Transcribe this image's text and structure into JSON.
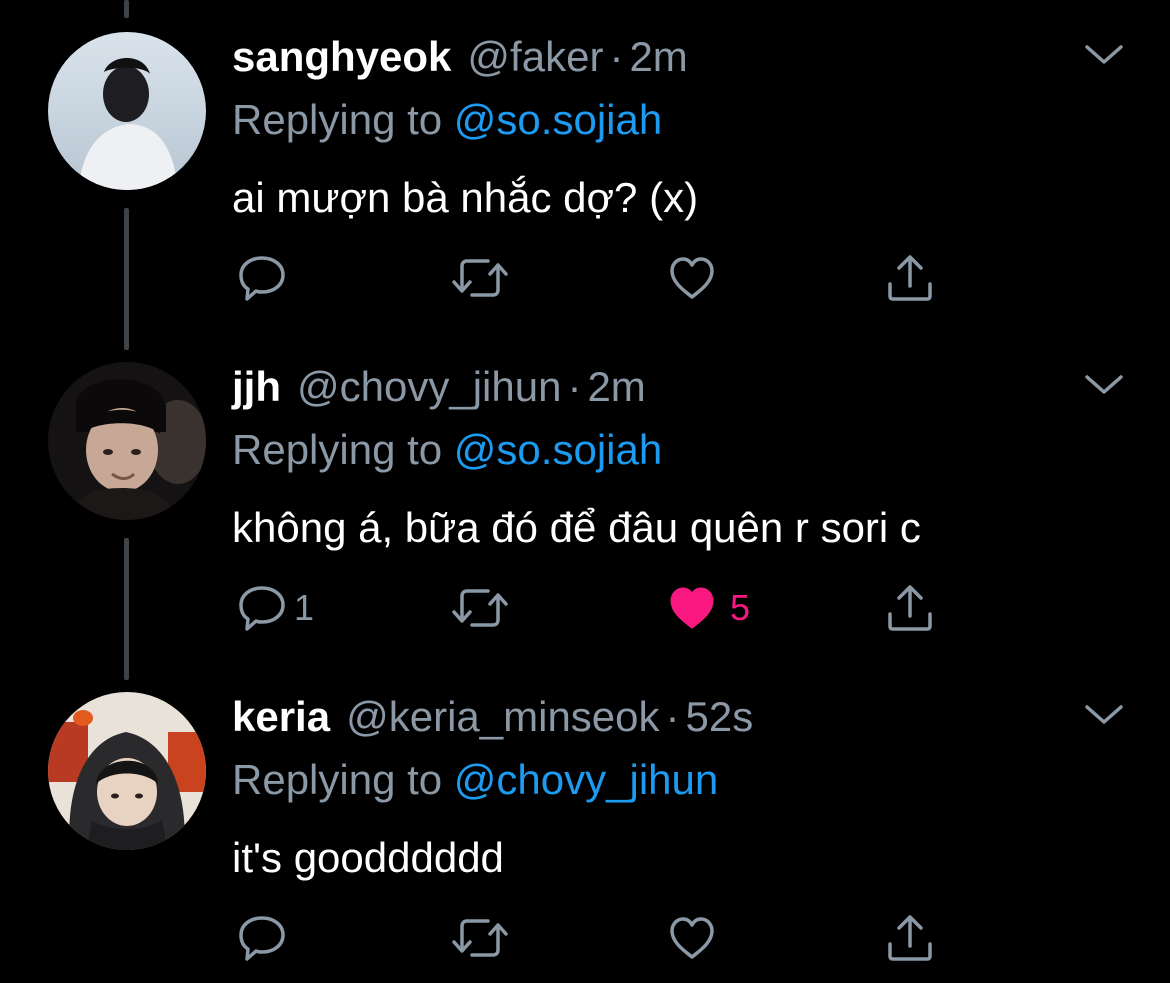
{
  "colors": {
    "background": "#000000",
    "text_primary": "#ffffff",
    "text_secondary": "#8b98a5",
    "mention": "#1d9bf0",
    "like_active": "#f91880",
    "thread_line": "#3d4349"
  },
  "tweets": [
    {
      "display_name": "sanghyeok",
      "handle": "@faker",
      "separator": "·",
      "time": "2m",
      "replying_prefix": "Replying to ",
      "replying_to": "@so.sojiah",
      "text": "ai mượn bà nhắc dợ? (x)",
      "reply_count": "",
      "retweet_count": "",
      "like_count": "",
      "liked": false,
      "avatar_icon": "avatar-photo"
    },
    {
      "display_name": "jjh",
      "handle": "@chovy_jihun",
      "separator": "·",
      "time": "2m",
      "replying_prefix": "Replying to ",
      "replying_to": "@so.sojiah",
      "text": "không á, bữa đó để đâu quên r sori c",
      "reply_count": "1",
      "retweet_count": "",
      "like_count": "5",
      "liked": true,
      "avatar_icon": "avatar-photo"
    },
    {
      "display_name": "keria",
      "handle": "@keria_minseok",
      "separator": "·",
      "time": "52s",
      "replying_prefix": "Replying to ",
      "replying_to": "@chovy_jihun",
      "text": "it's goodddddd",
      "reply_count": "",
      "retweet_count": "",
      "like_count": "",
      "liked": false,
      "avatar_icon": "avatar-photo"
    }
  ],
  "icons": {
    "reply": "reply-icon",
    "retweet": "retweet-icon",
    "like": "heart-icon",
    "share": "share-icon",
    "menu": "chevron-down-icon"
  }
}
